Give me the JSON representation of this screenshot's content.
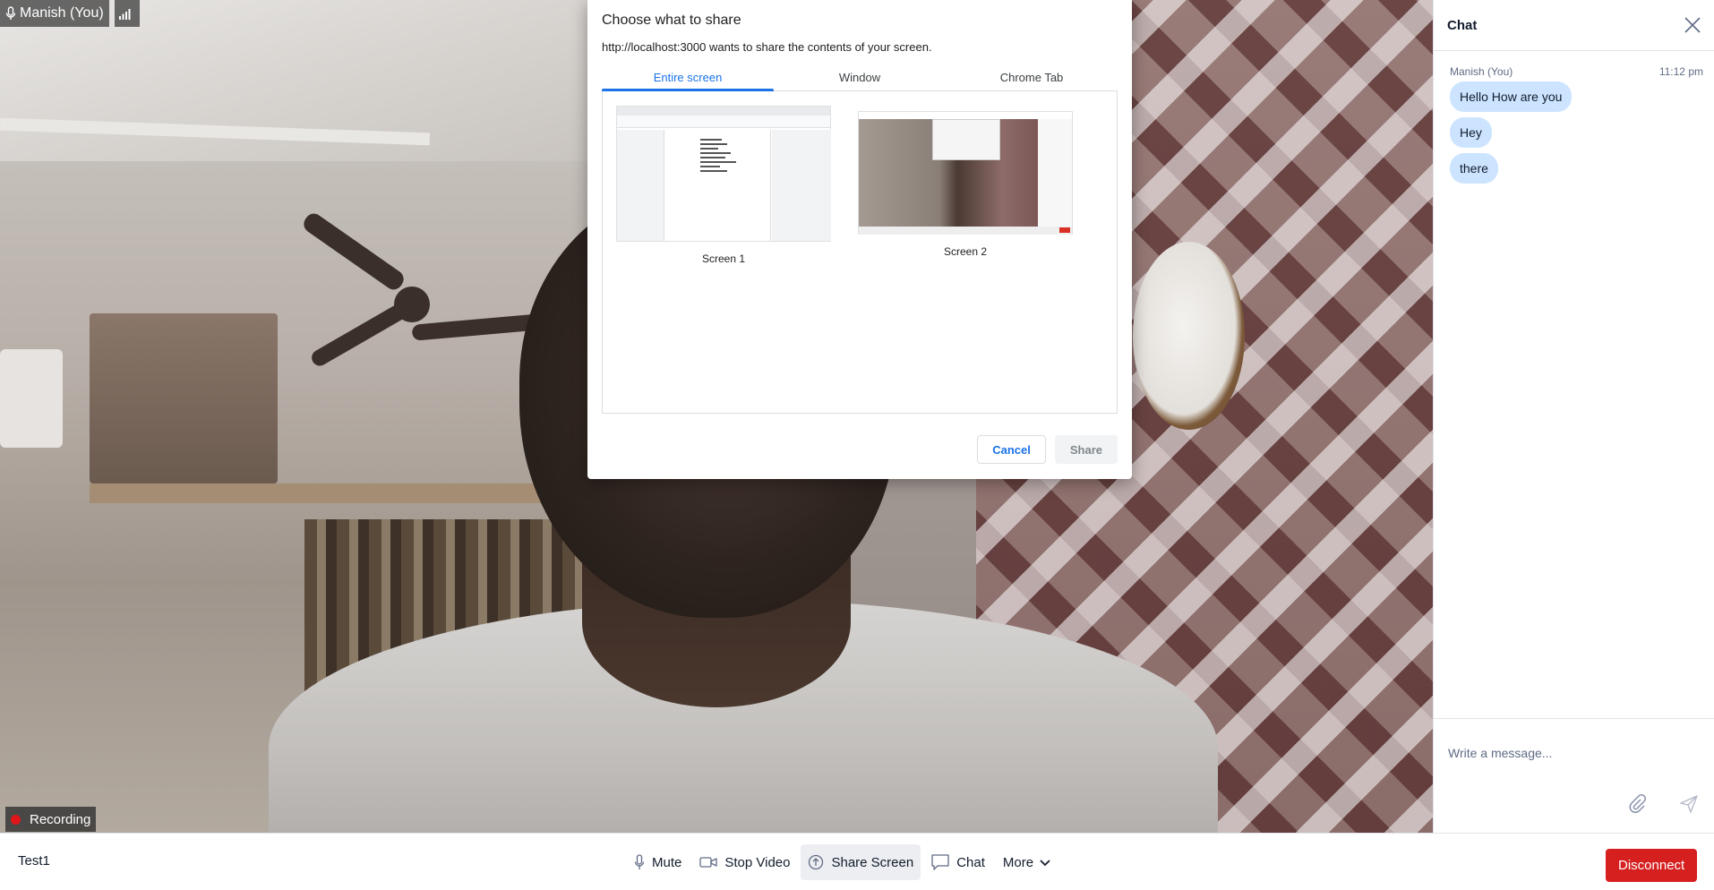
{
  "participant": {
    "name": "Manish (You)"
  },
  "recording": {
    "label": "Recording"
  },
  "dialog": {
    "title": "Choose what to share",
    "subtitle": "http://localhost:3000 wants to share the contents of your screen.",
    "tabs": [
      {
        "label": "Entire screen",
        "active": true
      },
      {
        "label": "Window",
        "active": false
      },
      {
        "label": "Chrome Tab",
        "active": false
      }
    ],
    "screens": [
      {
        "label": "Screen 1"
      },
      {
        "label": "Screen 2"
      }
    ],
    "cancel_label": "Cancel",
    "share_label": "Share"
  },
  "chat": {
    "title": "Chat",
    "messages": [
      {
        "author": "Manish (You)",
        "time": "11:12 pm",
        "texts": [
          "Hello How are you",
          "Hey",
          "there"
        ]
      }
    ],
    "input_placeholder": "Write a message..."
  },
  "bottom": {
    "room_name": "Test1",
    "controls": {
      "mute": "Mute",
      "stop_video": "Stop Video",
      "share_screen": "Share Screen",
      "chat": "Chat",
      "more": "More"
    },
    "disconnect": "Disconnect"
  },
  "colors": {
    "accent": "#1a73e8",
    "disconnect": "#d61f1f",
    "bubble": "#cce4ff",
    "recording_dot": "#e0161b"
  }
}
